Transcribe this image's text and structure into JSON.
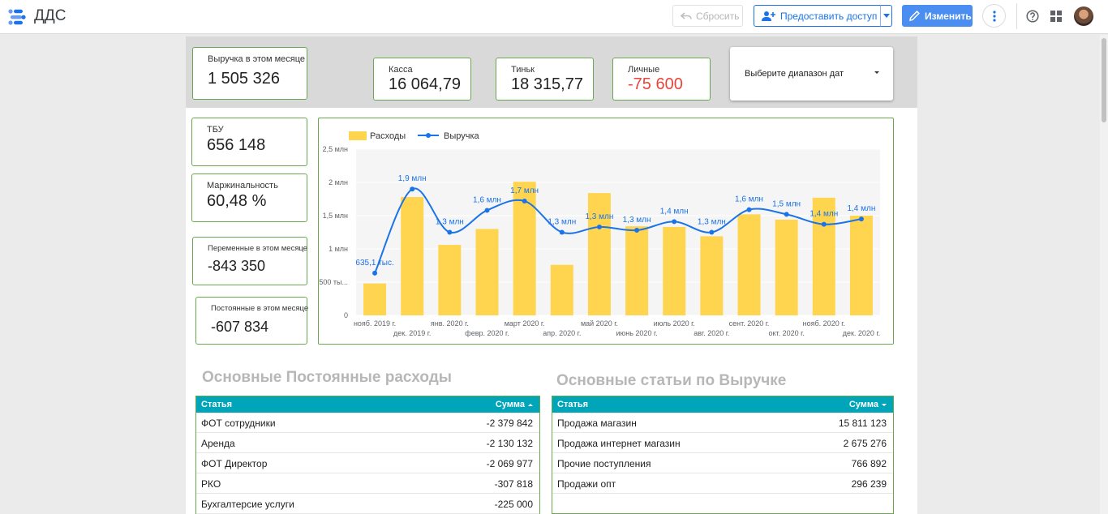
{
  "app": {
    "title": "ДДС"
  },
  "toolbar": {
    "reset_label": "Сбросить",
    "share_label": "Предоставить доступ",
    "edit_label": "Изменить"
  },
  "kpis": {
    "revenue_month": {
      "label": "Выручка в этом месяце",
      "value": "1 505 326"
    },
    "kassa": {
      "label": "Касса",
      "value": "16 064,79"
    },
    "tink": {
      "label": "Тиньк",
      "value": "18 315,77"
    },
    "personal": {
      "label": "Личные",
      "value": "-75 600"
    },
    "tbu": {
      "label": "ТБУ",
      "value": "656 148"
    },
    "margin": {
      "label": "Маржинальность",
      "value": "60,48 %"
    },
    "variable": {
      "label": "Переменные в этом месяце",
      "value": "-843 350"
    },
    "fixed": {
      "label": "Постоянные в этом месяце",
      "value": "-607 834"
    }
  },
  "date_picker": {
    "label": "Выберите диапазон дат"
  },
  "colors": {
    "bar": "#ffd54f",
    "line": "#1a73e8",
    "kpi_border": "#6aa84f",
    "table_header": "#00a5b9",
    "negative": "#e8453c"
  },
  "chart_data": {
    "type": "bar",
    "categories": [
      "нояб. 2019 г.",
      "дек. 2019 г.",
      "янв. 2020 г.",
      "февр. 2020 г.",
      "март 2020 г.",
      "апр. 2020 г.",
      "май 2020 г.",
      "июнь 2020 г.",
      "июль 2020 г.",
      "авг. 2020 г.",
      "сент. 2020 г.",
      "окт. 2020 г.",
      "нояб. 2020 г.",
      "дек. 2020 г."
    ],
    "series": [
      {
        "name": "Расходы",
        "type": "bar",
        "values": [
          480000,
          1780000,
          1060000,
          1300000,
          2010000,
          760000,
          1840000,
          1340000,
          1330000,
          1190000,
          1520000,
          1440000,
          1770000,
          1500000
        ]
      },
      {
        "name": "Выручка",
        "type": "line",
        "values": [
          635100,
          1900000,
          1250000,
          1580000,
          1720000,
          1250000,
          1330000,
          1280000,
          1410000,
          1250000,
          1590000,
          1520000,
          1370000,
          1450000
        ],
        "data_labels": [
          "635,1 тыс.",
          "1,9 млн",
          "1,3 млн",
          "1,6 млн",
          "1,7 млн",
          "1,3 млн",
          "1,3 млн",
          "1,3 млн",
          "1,4 млн",
          "1,3 млн",
          "1,6 млн",
          "1,5 млн",
          "1,4 млн",
          "1,4 млн"
        ]
      }
    ],
    "y_ticks": [
      {
        "value": 0,
        "label": "0"
      },
      {
        "value": 500000,
        "label": "500 ты..."
      },
      {
        "value": 1000000,
        "label": "1 млн"
      },
      {
        "value": 1500000,
        "label": "1,5 млн"
      },
      {
        "value": 2000000,
        "label": "2 млн"
      },
      {
        "value": 2500000,
        "label": "2,5 млн"
      }
    ],
    "ylim": [
      0,
      2500000
    ],
    "legend": "top-left"
  },
  "fixed_costs": {
    "title": "Основные Постоянные расходы",
    "col1": "Статья",
    "col2": "Сумма",
    "rows": [
      {
        "name": "ФОТ сотрудники",
        "value": "-2 379 842"
      },
      {
        "name": "Аренда",
        "value": "-2 130 132"
      },
      {
        "name": "ФОТ Директор",
        "value": "-2 069 977"
      },
      {
        "name": "РКО",
        "value": "-307 818"
      },
      {
        "name": "Бухгалтерсие услуги",
        "value": "-225 000"
      }
    ]
  },
  "revenue_items": {
    "title": "Основные статьи по Выручке",
    "col1": "Статья",
    "col2": "Сумма",
    "rows": [
      {
        "name": "Продажа магазин",
        "value": "15 811 123"
      },
      {
        "name": "Продажа интернет магазин",
        "value": "2 675 276"
      },
      {
        "name": "Прочие поступления",
        "value": "766 892"
      },
      {
        "name": "Продажи опт",
        "value": "296 239"
      }
    ]
  }
}
